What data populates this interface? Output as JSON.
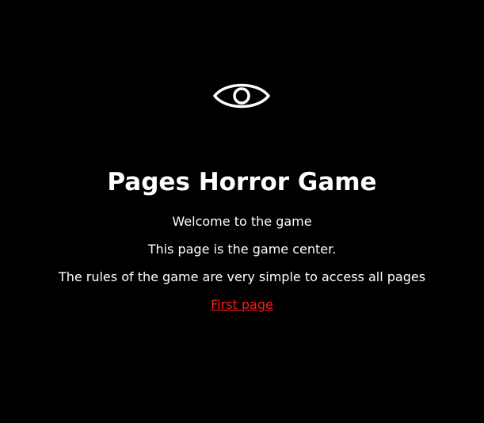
{
  "icon": "eye-icon",
  "colors": {
    "background": "#000000",
    "text": "#ffffff",
    "link": "#ff1a1a"
  },
  "title": "Pages Horror Game",
  "paragraphs": [
    "Welcome to the game",
    "This page is the game center.",
    "The rules of the game are very simple to access all pages"
  ],
  "link": {
    "label": "First page"
  }
}
